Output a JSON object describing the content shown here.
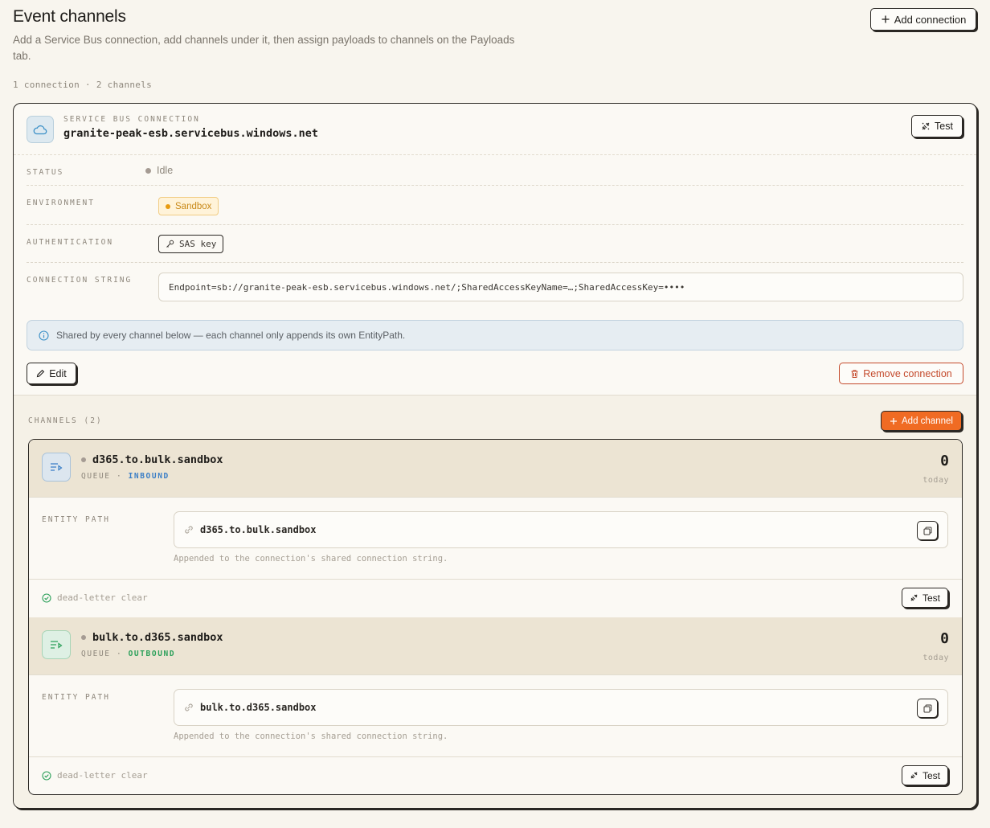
{
  "header": {
    "title": "Event channels",
    "description": "Add a Service Bus connection, add channels under it, then assign payloads to channels on the Payloads tab.",
    "summary": "1 connection · 2 channels",
    "add_connection_label": "Add connection"
  },
  "connection": {
    "kicker": "Service Bus connection",
    "name": "granite-peak-esb.servicebus.windows.net",
    "test_label": "Test",
    "status_label": "Status",
    "status_value": "Idle",
    "environment_label": "Environment",
    "environment_value": "Sandbox",
    "auth_label": "Authentication",
    "auth_value": "SAS key",
    "connstr_label": "Connection string",
    "connstr_value": "Endpoint=sb://granite-peak-esb.servicebus.windows.net/;SharedAccessKeyName=…;SharedAccessKey=••••",
    "info_text": "Shared by every channel below — each channel only appends its own EntityPath.",
    "edit_label": "Edit",
    "remove_label": "Remove connection"
  },
  "channels": {
    "section_label": "Channels (2)",
    "add_channel_label": "Add channel",
    "items": [
      {
        "name": "d365.to.bulk.sandbox",
        "type": "QUEUE",
        "separator": "·",
        "direction": "INBOUND",
        "count": "0",
        "count_label": "today",
        "entity_path_label": "Entity path",
        "entity_path": "d365.to.bulk.sandbox",
        "hint": "Appended to the connection's shared connection string.",
        "dead_letter": "dead-letter clear",
        "test_label": "Test"
      },
      {
        "name": "bulk.to.d365.sandbox",
        "type": "QUEUE",
        "separator": "·",
        "direction": "OUTBOUND",
        "count": "0",
        "count_label": "today",
        "entity_path_label": "Entity path",
        "entity_path": "bulk.to.d365.sandbox",
        "hint": "Appended to the connection's shared connection string.",
        "dead_letter": "dead-letter clear",
        "test_label": "Test"
      }
    ]
  },
  "colors": {
    "accent": "#f06b23",
    "inbound": "#3a7ec6",
    "outbound": "#2ca05a",
    "sandbox": "#e89b10",
    "danger": "#c44a2c"
  },
  "icons": [
    "plus-icon",
    "cloud-icon",
    "plug-icon",
    "key-icon",
    "info-icon",
    "pencil-icon",
    "trash-icon",
    "queue-icon",
    "link-icon",
    "copy-icon",
    "check-circle-icon"
  ]
}
